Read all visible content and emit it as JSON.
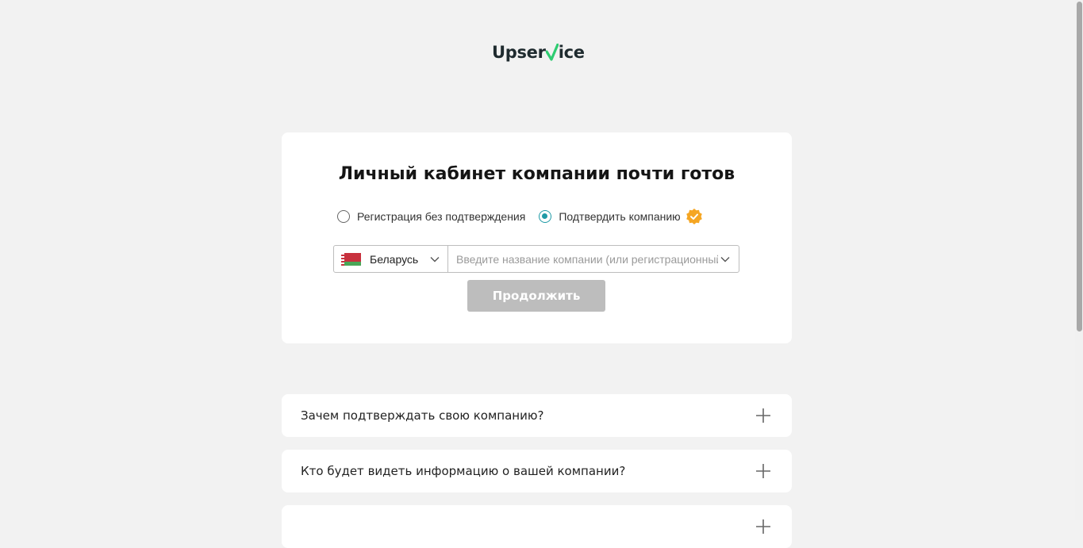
{
  "logo": {
    "prefix": "Upser",
    "suffix": "ice"
  },
  "card": {
    "title": "Личный кабинет компании почти готов",
    "radio_options": [
      {
        "label": "Регистрация без подтверждения",
        "checked": false
      },
      {
        "label": "Подтвердить компанию",
        "checked": true
      }
    ],
    "country": {
      "value": "Беларусь",
      "flag": "belarus-flag"
    },
    "company_input": {
      "value": "",
      "placeholder": "Введите название компании (или регистрационный номер)"
    },
    "continue_label": "Продолжить"
  },
  "faq": [
    {
      "question": "Зачем подтверждать свою компанию?"
    },
    {
      "question": "Кто будет видеть информацию о вашей компании?"
    }
  ],
  "colors": {
    "accent": "#1e9aa6",
    "badge": "#f5a623",
    "button_disabled": "#bdbdbd",
    "logo_check": "#2ecc71"
  }
}
